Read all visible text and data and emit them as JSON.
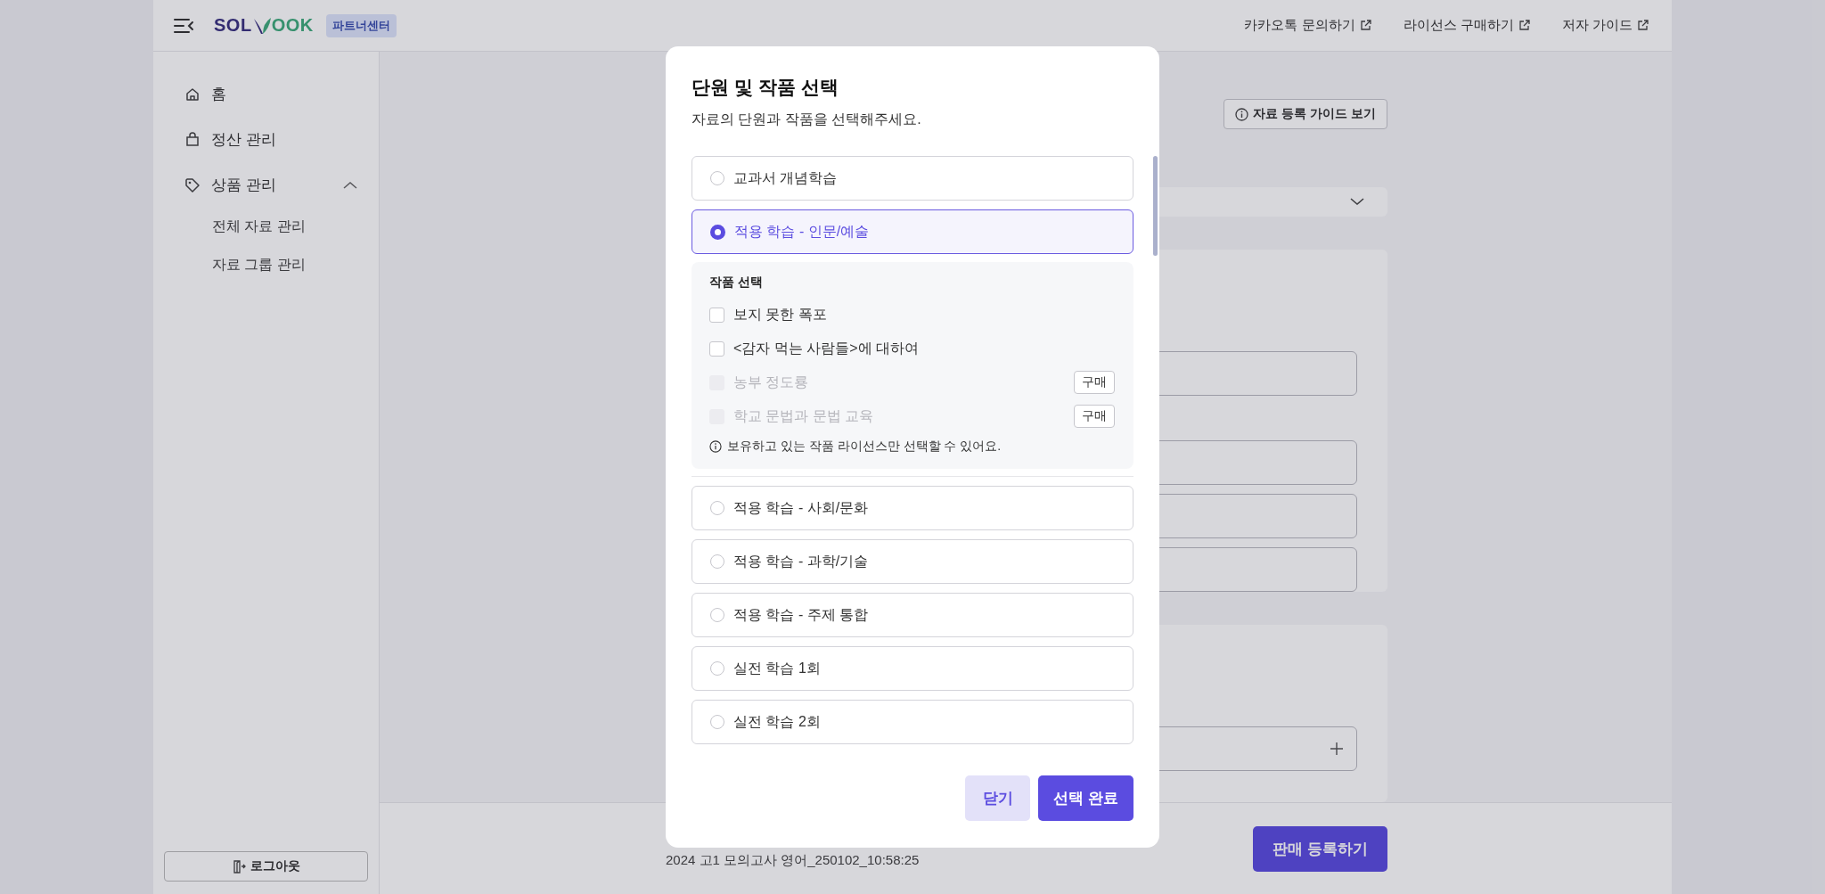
{
  "header": {
    "logo": {
      "left": "SOL",
      "right": "OOK"
    },
    "badge": "파트너센터",
    "links": [
      "카카오톡 문의하기",
      "라이선스 구매하기",
      "저자 가이드"
    ]
  },
  "sidebar": {
    "items": [
      {
        "label": "홈"
      },
      {
        "label": "정산 관리"
      },
      {
        "label": "상품 관리",
        "expanded": true,
        "children": [
          {
            "label": "전체 자료 관리"
          },
          {
            "label": "자료 그룹 관리"
          }
        ]
      }
    ],
    "logout": "로그아웃"
  },
  "main": {
    "guide_button": "자료 등록 가이드 보기",
    "footer": {
      "title": "2024 고1 모의고사 영어_250102_10:58:25",
      "submit": "판매 등록하기"
    }
  },
  "modal": {
    "title": "단원 및 작품 선택",
    "subtitle": "자료의 단원과 작품을 선택해주세요.",
    "options": [
      {
        "label": "교과서 개념학습",
        "selected": false
      },
      {
        "label": "적용 학습 - 인문/예술",
        "selected": true,
        "works": {
          "heading": "작품 선택",
          "items": [
            {
              "label": "보지 못한 폭포",
              "checked": false,
              "disabled": false
            },
            {
              "label": "<감자 먹는 사람들>에 대하여",
              "checked": false,
              "disabled": false
            },
            {
              "label": "농부 정도룡",
              "checked": false,
              "disabled": true,
              "buy": "구매"
            },
            {
              "label": "학교 문법과 문법 교육",
              "checked": false,
              "disabled": true,
              "buy": "구매"
            }
          ],
          "note": "보유하고 있는 작품 라이선스만 선택할 수 있어요."
        }
      },
      {
        "label": "적용 학습 - 사회/문화",
        "selected": false
      },
      {
        "label": "적용 학습 - 과학/기술",
        "selected": false
      },
      {
        "label": "적용 학습 - 주제 통합",
        "selected": false
      },
      {
        "label": "실전 학습 1회",
        "selected": false
      },
      {
        "label": "실전 학습 2회",
        "selected": false
      }
    ],
    "buttons": {
      "close": "닫기",
      "confirm": "선택 완료"
    }
  }
}
